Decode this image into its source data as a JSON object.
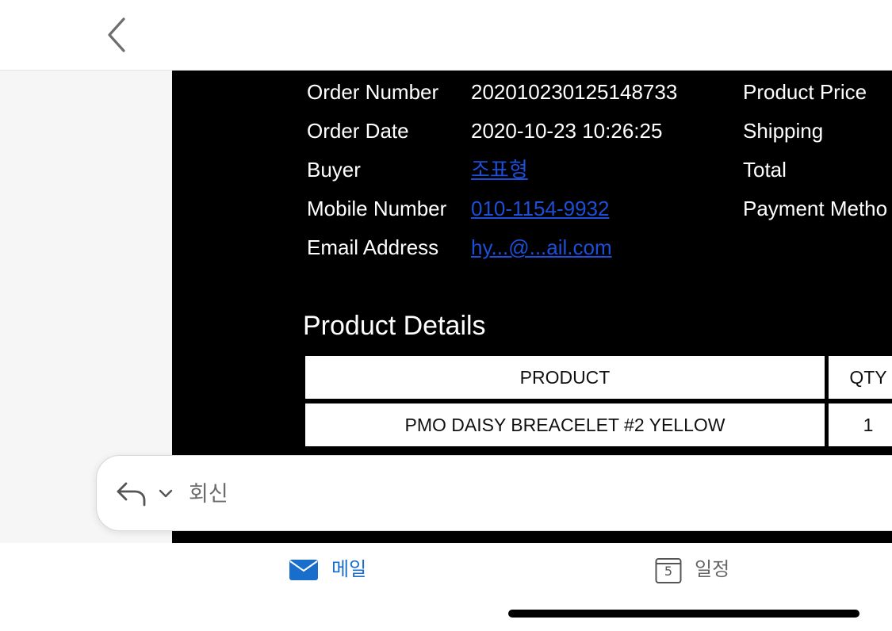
{
  "order_info": {
    "rows": [
      {
        "label": "Order Number",
        "value": "20201023012514873",
        "value_suffix": "3",
        "right_label": "Product Price"
      },
      {
        "label": "Order Date",
        "value": "2020-10-23 10:26:25",
        "right_label": "Shipping"
      },
      {
        "label": "Buyer",
        "value": "조표형",
        "right_label": "Total"
      },
      {
        "label": "Mobile Number",
        "value": "010-1154-9932",
        "right_label": "Payment Metho"
      },
      {
        "label": "Email Address",
        "value": "hy...@...ail.com"
      }
    ]
  },
  "product_details": {
    "heading": "Product Details",
    "columns": [
      "PRODUCT",
      "QTY"
    ],
    "rows": [
      {
        "product": "PMO DAISY BREACELET #2 YELLOW",
        "qty": "1"
      }
    ]
  },
  "reply": {
    "label": "회신"
  },
  "tabs": {
    "mail": {
      "label": "메일"
    },
    "calendar": {
      "label": "일정",
      "day": "5"
    }
  },
  "colors": {
    "accent": "#1a6ecb",
    "link": "#1d4ed8",
    "email_bg": "#000000"
  }
}
